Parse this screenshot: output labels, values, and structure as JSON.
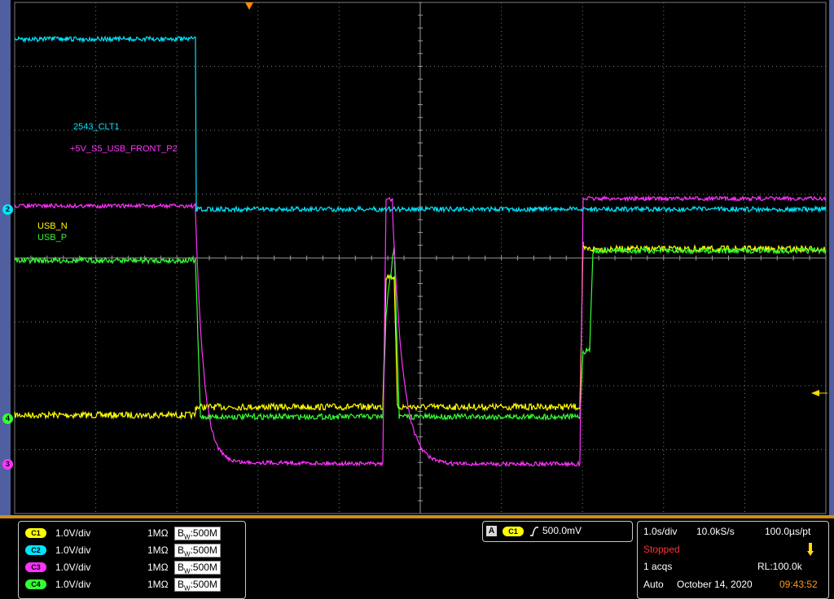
{
  "channel_labels": {
    "ch2": "2543_CLT1",
    "ch3": "+5V_S5_USB_FRONT_P2",
    "ch1": "USB_N",
    "ch4": "USB_P"
  },
  "channel_markers": {
    "ch2": "2",
    "ch4": "4",
    "ch3": "3"
  },
  "channels": [
    {
      "badge": "C1",
      "vdiv": "1.0V/div",
      "impedance": "1MΩ",
      "bw_prefix": "B",
      "bw_sub": "W",
      "bw_value": ":500M",
      "color": "#ffff00"
    },
    {
      "badge": "C2",
      "vdiv": "1.0V/div",
      "impedance": "1MΩ",
      "bw_prefix": "B",
      "bw_sub": "W",
      "bw_value": ":500M",
      "color": "#00e5ff"
    },
    {
      "badge": "C3",
      "vdiv": "1.0V/div",
      "impedance": "1MΩ",
      "bw_prefix": "B",
      "bw_sub": "W",
      "bw_value": ":500M",
      "color": "#ff33ff"
    },
    {
      "badge": "C4",
      "vdiv": "1.0V/div",
      "impedance": "1MΩ",
      "bw_prefix": "B",
      "bw_sub": "W",
      "bw_value": ":500M",
      "color": "#33ff33"
    }
  ],
  "trigger": {
    "label": "A",
    "source": "C1",
    "level": "500.0mV"
  },
  "acquisition": {
    "time_div": "1.0s/div",
    "sample_rate": "10.0kS/s",
    "time_per_point": "100.0µs/pt",
    "state": "Stopped",
    "acqs": "1 acqs",
    "record_length": "RL:100.0k",
    "mode": "Auto",
    "date": "October 14, 2020",
    "time": "09:43:52"
  },
  "colors": {
    "ch1": "#ffff00",
    "ch2": "#00e5ff",
    "ch3": "#ff33ff",
    "ch4": "#33ff33",
    "grid": "#7a7a7a",
    "bezel": "#4f5fa0",
    "accent": "#d08f15",
    "stopped": "#ff3333"
  }
}
